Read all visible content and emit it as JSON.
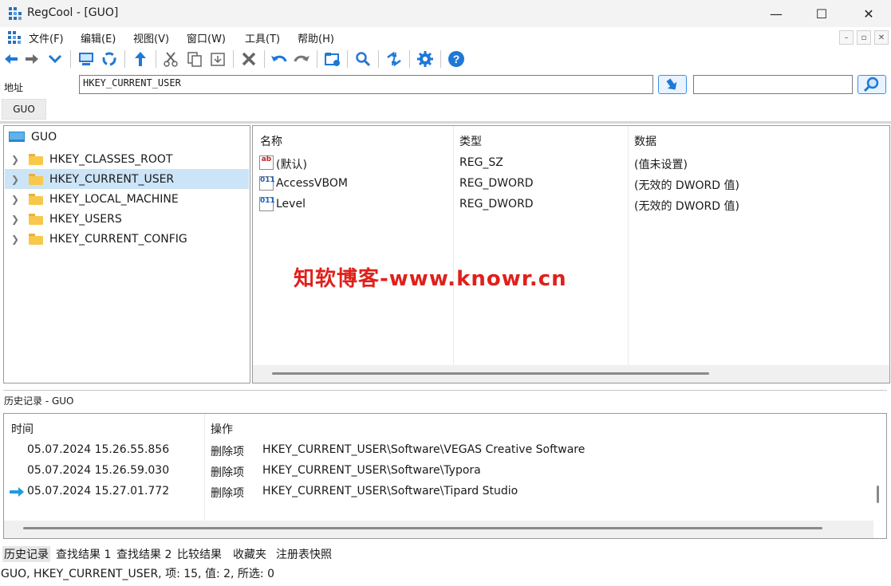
{
  "window": {
    "title": "RegCool - [GUO]",
    "minimize": "—",
    "maximize": "☐",
    "close": "✕"
  },
  "menu": {
    "items": [
      "文件(F)",
      "编辑(E)",
      "视图(V)",
      "窗口(W)",
      "工具(T)",
      "帮助(H)"
    ],
    "mdi_min": "–",
    "mdi_restore": "▫",
    "mdi_close": "✕"
  },
  "toolbar": {
    "icons": [
      "back-icon",
      "forward-icon",
      "dropdown-icon",
      "computer-icon",
      "refresh-icon",
      "up-icon",
      "cut-icon",
      "copy-icon",
      "paste-icon",
      "delete-icon",
      "undo-icon",
      "redo-icon",
      "new-key-icon",
      "search-icon",
      "compare-icon",
      "settings-icon",
      "help-icon"
    ]
  },
  "address": {
    "label": "地址",
    "value": "HKEY_CURRENT_USER",
    "search_value": ""
  },
  "doc_tab": "GUO",
  "tree": {
    "root": "GUO",
    "nodes": [
      {
        "label": "HKEY_CLASSES_ROOT",
        "selected": false
      },
      {
        "label": "HKEY_CURRENT_USER",
        "selected": true
      },
      {
        "label": "HKEY_LOCAL_MACHINE",
        "selected": false
      },
      {
        "label": "HKEY_USERS",
        "selected": false
      },
      {
        "label": "HKEY_CURRENT_CONFIG",
        "selected": false
      }
    ]
  },
  "values": {
    "columns": [
      "名称",
      "类型",
      "数据"
    ],
    "rows": [
      {
        "icon": "ab",
        "name": "(默认)",
        "type": "REG_SZ",
        "data": "(值未设置)"
      },
      {
        "icon": "011",
        "name": "AccessVBOM",
        "type": "REG_DWORD",
        "data": "(无效的 DWORD 值)"
      },
      {
        "icon": "011",
        "name": "Level",
        "type": "REG_DWORD",
        "data": "(无效的 DWORD 值)"
      }
    ]
  },
  "watermark": "知软博客-www.knowr.cn",
  "history": {
    "title": "历史记录 - GUO",
    "columns": [
      "时间",
      "操作"
    ],
    "rows": [
      {
        "time": "05.07.2024 15.26.55.856",
        "action": "删除项",
        "path": "HKEY_CURRENT_USER\\Software\\VEGAS Creative Software",
        "current": false
      },
      {
        "time": "05.07.2024 15.26.59.030",
        "action": "删除项",
        "path": "HKEY_CURRENT_USER\\Software\\Typora",
        "current": false
      },
      {
        "time": "05.07.2024 15.27.01.772",
        "action": "删除项",
        "path": "HKEY_CURRENT_USER\\Software\\Tipard Studio",
        "current": true
      }
    ]
  },
  "bottom_tabs": [
    "历史记录",
    "查找结果 1",
    "查找结果 2",
    "比较结果",
    "收藏夹",
    "注册表快照"
  ],
  "status": "GUO, HKEY_CURRENT_USER, 项: 15, 值: 2, 所选: 0",
  "colors": {
    "accent": "#1e78d7",
    "selection": "#cce4f7",
    "watermark": "#e0201b"
  }
}
